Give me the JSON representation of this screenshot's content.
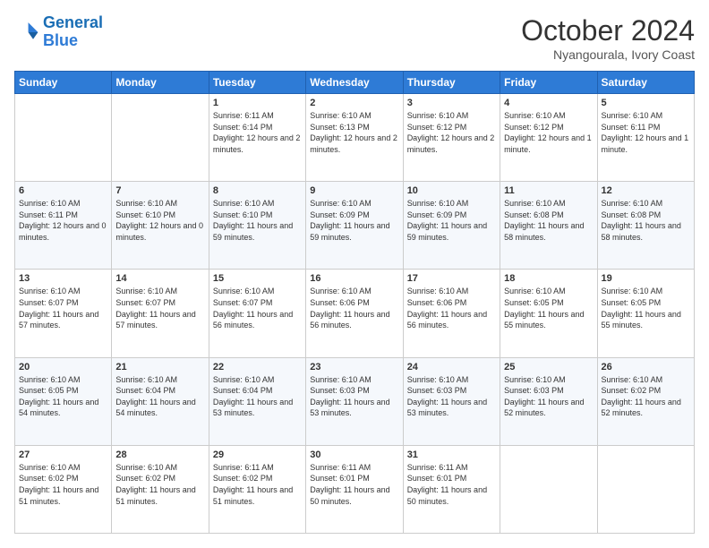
{
  "logo": {
    "line1": "General",
    "line2": "Blue"
  },
  "title": "October 2024",
  "location": "Nyangourala, Ivory Coast",
  "weekdays": [
    "Sunday",
    "Monday",
    "Tuesday",
    "Wednesday",
    "Thursday",
    "Friday",
    "Saturday"
  ],
  "weeks": [
    [
      null,
      null,
      {
        "day": 1,
        "sunrise": "6:11 AM",
        "sunset": "6:14 PM",
        "daylight": "12 hours and 2 minutes."
      },
      {
        "day": 2,
        "sunrise": "6:10 AM",
        "sunset": "6:13 PM",
        "daylight": "12 hours and 2 minutes."
      },
      {
        "day": 3,
        "sunrise": "6:10 AM",
        "sunset": "6:12 PM",
        "daylight": "12 hours and 2 minutes."
      },
      {
        "day": 4,
        "sunrise": "6:10 AM",
        "sunset": "6:12 PM",
        "daylight": "12 hours and 1 minute."
      },
      {
        "day": 5,
        "sunrise": "6:10 AM",
        "sunset": "6:11 PM",
        "daylight": "12 hours and 1 minute."
      }
    ],
    [
      {
        "day": 6,
        "sunrise": "6:10 AM",
        "sunset": "6:11 PM",
        "daylight": "12 hours and 0 minutes."
      },
      {
        "day": 7,
        "sunrise": "6:10 AM",
        "sunset": "6:10 PM",
        "daylight": "12 hours and 0 minutes."
      },
      {
        "day": 8,
        "sunrise": "6:10 AM",
        "sunset": "6:10 PM",
        "daylight": "11 hours and 59 minutes."
      },
      {
        "day": 9,
        "sunrise": "6:10 AM",
        "sunset": "6:09 PM",
        "daylight": "11 hours and 59 minutes."
      },
      {
        "day": 10,
        "sunrise": "6:10 AM",
        "sunset": "6:09 PM",
        "daylight": "11 hours and 59 minutes."
      },
      {
        "day": 11,
        "sunrise": "6:10 AM",
        "sunset": "6:08 PM",
        "daylight": "11 hours and 58 minutes."
      },
      {
        "day": 12,
        "sunrise": "6:10 AM",
        "sunset": "6:08 PM",
        "daylight": "11 hours and 58 minutes."
      }
    ],
    [
      {
        "day": 13,
        "sunrise": "6:10 AM",
        "sunset": "6:07 PM",
        "daylight": "11 hours and 57 minutes."
      },
      {
        "day": 14,
        "sunrise": "6:10 AM",
        "sunset": "6:07 PM",
        "daylight": "11 hours and 57 minutes."
      },
      {
        "day": 15,
        "sunrise": "6:10 AM",
        "sunset": "6:07 PM",
        "daylight": "11 hours and 56 minutes."
      },
      {
        "day": 16,
        "sunrise": "6:10 AM",
        "sunset": "6:06 PM",
        "daylight": "11 hours and 56 minutes."
      },
      {
        "day": 17,
        "sunrise": "6:10 AM",
        "sunset": "6:06 PM",
        "daylight": "11 hours and 56 minutes."
      },
      {
        "day": 18,
        "sunrise": "6:10 AM",
        "sunset": "6:05 PM",
        "daylight": "11 hours and 55 minutes."
      },
      {
        "day": 19,
        "sunrise": "6:10 AM",
        "sunset": "6:05 PM",
        "daylight": "11 hours and 55 minutes."
      }
    ],
    [
      {
        "day": 20,
        "sunrise": "6:10 AM",
        "sunset": "6:05 PM",
        "daylight": "11 hours and 54 minutes."
      },
      {
        "day": 21,
        "sunrise": "6:10 AM",
        "sunset": "6:04 PM",
        "daylight": "11 hours and 54 minutes."
      },
      {
        "day": 22,
        "sunrise": "6:10 AM",
        "sunset": "6:04 PM",
        "daylight": "11 hours and 53 minutes."
      },
      {
        "day": 23,
        "sunrise": "6:10 AM",
        "sunset": "6:03 PM",
        "daylight": "11 hours and 53 minutes."
      },
      {
        "day": 24,
        "sunrise": "6:10 AM",
        "sunset": "6:03 PM",
        "daylight": "11 hours and 53 minutes."
      },
      {
        "day": 25,
        "sunrise": "6:10 AM",
        "sunset": "6:03 PM",
        "daylight": "11 hours and 52 minutes."
      },
      {
        "day": 26,
        "sunrise": "6:10 AM",
        "sunset": "6:02 PM",
        "daylight": "11 hours and 52 minutes."
      }
    ],
    [
      {
        "day": 27,
        "sunrise": "6:10 AM",
        "sunset": "6:02 PM",
        "daylight": "11 hours and 51 minutes."
      },
      {
        "day": 28,
        "sunrise": "6:10 AM",
        "sunset": "6:02 PM",
        "daylight": "11 hours and 51 minutes."
      },
      {
        "day": 29,
        "sunrise": "6:11 AM",
        "sunset": "6:02 PM",
        "daylight": "11 hours and 51 minutes."
      },
      {
        "day": 30,
        "sunrise": "6:11 AM",
        "sunset": "6:01 PM",
        "daylight": "11 hours and 50 minutes."
      },
      {
        "day": 31,
        "sunrise": "6:11 AM",
        "sunset": "6:01 PM",
        "daylight": "11 hours and 50 minutes."
      },
      null,
      null
    ]
  ]
}
